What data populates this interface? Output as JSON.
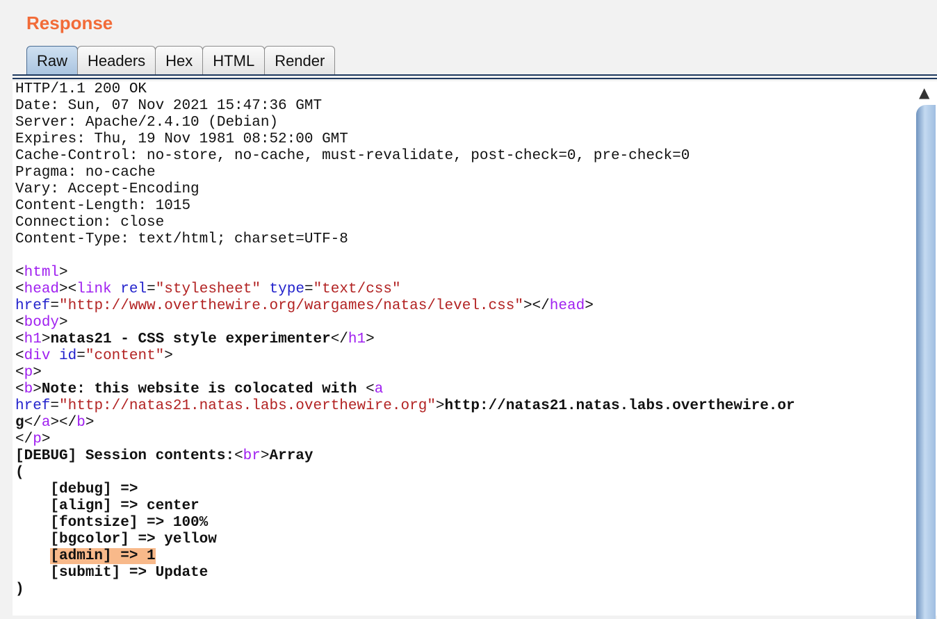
{
  "header": {
    "title": "Response"
  },
  "tabs": [
    {
      "label": "Raw",
      "active": true
    },
    {
      "label": "Headers",
      "active": false
    },
    {
      "label": "Hex",
      "active": false
    },
    {
      "label": "HTML",
      "active": false
    },
    {
      "label": "Render",
      "active": false
    }
  ],
  "colors": {
    "title": "#f26b38",
    "tag": "#a020f0",
    "attribute": "#2222cc",
    "attribute_value": "#b22222",
    "highlight": "#f8b98a",
    "active_tab": "#a9c4e0"
  },
  "response": {
    "headers": [
      "HTTP/1.1 200 OK",
      "Date: Sun, 07 Nov 2021 15:47:36 GMT",
      "Server: Apache/2.4.10 (Debian)",
      "Expires: Thu, 19 Nov 1981 08:52:00 GMT",
      "Cache-Control: no-store, no-cache, must-revalidate, post-check=0, pre-check=0",
      "Pragma: no-cache",
      "Vary: Accept-Encoding",
      "Content-Length: 1015",
      "Connection: close",
      "Content-Type: text/html; charset=UTF-8"
    ],
    "body": {
      "tag_html": "html",
      "tag_head": "head",
      "tag_link": "link",
      "attr_rel": "rel",
      "val_rel": "\"stylesheet\"",
      "attr_type": "type",
      "val_type": "\"text/css\"",
      "attr_href": "href",
      "val_href_css": "\"http://www.overthewire.org/wargames/natas/level.css\"",
      "tag_body": "body",
      "tag_h1": "h1",
      "h1_text": "natas21 - CSS style experimenter",
      "tag_div": "div",
      "attr_id": "id",
      "val_id": "\"content\"",
      "tag_p": "p",
      "tag_b": "b",
      "note_text": "Note: this website is colocated with ",
      "tag_a": "a",
      "val_href_link": "\"http://natas21.natas.labs.overthewire.org\"",
      "link_text_1": "http://natas21.natas.labs.overthewire.or",
      "link_text_2": "g",
      "debug_text": "[DEBUG] Session contents:",
      "tag_br": "br",
      "array_text": "Array",
      "open_paren": "(",
      "close_paren": ")",
      "session_entries": [
        "[debug] =>",
        "[align] => center",
        "[fontsize] => 100%",
        "[bgcolor] => yellow",
        "[admin] => 1",
        "[submit] => Update"
      ],
      "highlighted_entry_index": 4
    }
  },
  "scrollbar": {
    "up_icon": "▲"
  }
}
